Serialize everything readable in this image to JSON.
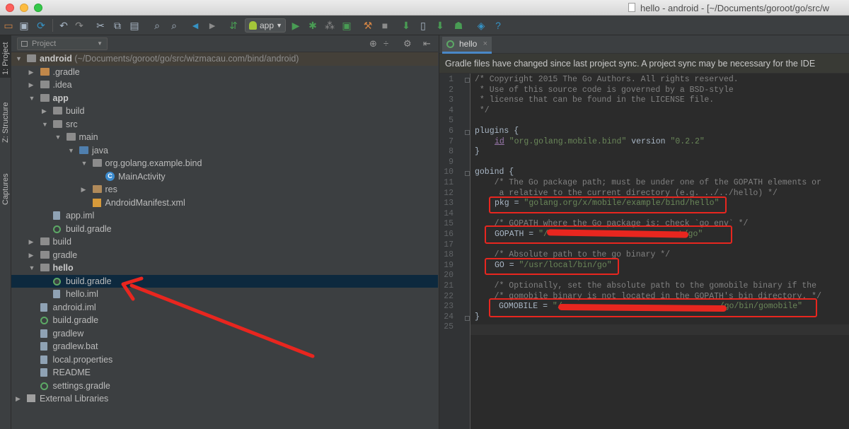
{
  "window": {
    "title": "hello - android - [~/Documents/goroot/go/src/w"
  },
  "toolbar": {
    "run_config": "app",
    "icons": [
      "open-folder-icon",
      "save-icon",
      "sync-icon",
      "undo-icon",
      "redo-icon",
      "cut-icon",
      "copy-icon",
      "paste-icon",
      "find-icon",
      "replace-icon",
      "back-icon",
      "forward-icon",
      "make-icon",
      "run-icon",
      "debug-icon",
      "attach-icon",
      "run-coverage-icon",
      "stop-icon",
      "project-structure-icon",
      "sdk-manager-icon",
      "avd-manager-icon",
      "android-device-monitor-icon",
      "sync-gradle-icon",
      "help-icon"
    ]
  },
  "stripe": {
    "tabs": [
      "1: Project",
      "Z: Structure",
      "Captures"
    ]
  },
  "project": {
    "view_label": "Project",
    "tree": [
      {
        "label": "android",
        "sub": "(~/Documents/goroot/go/src/wizmacau.com/bind/android)",
        "icon": "module-folder",
        "level": 0,
        "arrow": "down",
        "bold": true
      },
      {
        "label": ".gradle",
        "icon": "folder-orange",
        "level": 1,
        "arrow": "right"
      },
      {
        "label": ".idea",
        "icon": "folder",
        "level": 1,
        "arrow": "right"
      },
      {
        "label": "app",
        "icon": "module-folder",
        "level": 1,
        "arrow": "down",
        "bold": true
      },
      {
        "label": "build",
        "icon": "folder",
        "level": 2,
        "arrow": "right"
      },
      {
        "label": "src",
        "icon": "folder",
        "level": 2,
        "arrow": "down"
      },
      {
        "label": "main",
        "icon": "folder",
        "level": 3,
        "arrow": "down"
      },
      {
        "label": "java",
        "icon": "folder-blue",
        "level": 4,
        "arrow": "down"
      },
      {
        "label": "org.golang.example.bind",
        "icon": "package",
        "level": 5,
        "arrow": "down"
      },
      {
        "label": "MainActivity",
        "icon": "class",
        "level": 6,
        "arrow": ""
      },
      {
        "label": "res",
        "icon": "folder-tan",
        "level": 5,
        "arrow": "right"
      },
      {
        "label": "AndroidManifest.xml",
        "icon": "xml",
        "level": 5,
        "arrow": ""
      },
      {
        "label": "app.iml",
        "icon": "iml",
        "level": 2,
        "arrow": ""
      },
      {
        "label": "build.gradle",
        "icon": "gradle",
        "level": 2,
        "arrow": ""
      },
      {
        "label": "build",
        "icon": "folder",
        "level": 1,
        "arrow": "right"
      },
      {
        "label": "gradle",
        "icon": "folder",
        "level": 1,
        "arrow": "right"
      },
      {
        "label": "hello",
        "icon": "module-folder",
        "level": 1,
        "arrow": "down",
        "bold": true
      },
      {
        "label": "build.gradle",
        "icon": "gradle",
        "level": 2,
        "arrow": "",
        "selected": true
      },
      {
        "label": "hello.iml",
        "icon": "iml",
        "level": 2,
        "arrow": ""
      },
      {
        "label": "android.iml",
        "icon": "iml",
        "level": 1,
        "arrow": ""
      },
      {
        "label": "build.gradle",
        "icon": "gradle",
        "level": 1,
        "arrow": ""
      },
      {
        "label": "gradlew",
        "icon": "file",
        "level": 1,
        "arrow": ""
      },
      {
        "label": "gradlew.bat",
        "icon": "file",
        "level": 1,
        "arrow": ""
      },
      {
        "label": "local.properties",
        "icon": "file",
        "level": 1,
        "arrow": ""
      },
      {
        "label": "README",
        "icon": "file",
        "level": 1,
        "arrow": ""
      },
      {
        "label": "settings.gradle",
        "icon": "gradle",
        "level": 1,
        "arrow": ""
      },
      {
        "label": "External Libraries",
        "icon": "library",
        "level": 0,
        "arrow": "right"
      }
    ]
  },
  "editor": {
    "tab_label": "hello",
    "notice": "Gradle files have changed since last project sync. A project sync may be necessary for the IDE",
    "lines": [
      "/* Copyright 2015 The Go Authors. All rights reserved.",
      " * Use of this source code is governed by a BSD-style",
      " * license that can be found in the LICENSE file.",
      " */",
      "",
      "plugins {",
      "    id \"org.golang.mobile.bind\" version \"0.2.2\"",
      "}",
      "",
      "gobind {",
      "    /* The Go package path; must be under one of the GOPATH elements or",
      "     a relative to the current directory (e.g. ../../hello) */",
      "    pkg = \"golang.org/x/mobile/example/bind/hello\"",
      "",
      "    /* GOPATH where the Go package is; check `go env` */",
      "    GOPATH = \"/Users/...oot/go\"",
      "",
      "    /* Absolute path to the go binary */",
      "    GO = \"/usr/local/bin/go\"",
      "",
      "    /* Optionally, set the absolute path to the gomobile binary if the",
      "    /* gomobile binary is not located in the GOPATH's bin directory. */",
      "    GOMOBILE = \"/Users/.../go/bin/gomobile\"",
      "}",
      ""
    ],
    "display": {
      "l1": "/* Copyright 2015 The Go Authors. All rights reserved.",
      "l2": " * Use of this source code is governed by a BSD-style",
      "l3": " * license that can be found in the LICENSE file.",
      "l4": " */",
      "l6": "plugins {",
      "l7a": "id",
      "l7b": "\"org.golang.mobile.bind\"",
      "l7c": "version",
      "l7d": "\"0.2.2\"",
      "l8": "}",
      "l10": "gobind {",
      "l11": "    /* The Go package path; must be under one of the GOPATH elements or",
      "l12": "     a relative to the current directory (e.g. ../../hello) */",
      "l13a": "pkg = ",
      "l13b": "\"golang.org/x/mobile/example/bind/hello\"",
      "l15": "    /* GOPATH where the Go package is; check `go env` */",
      "l16a": "GOPATH = ",
      "l16b": "\"/",
      "l16c": "oot/go\"",
      "l18": "    /* Absolute path to the go binary */",
      "l19a": "GO = ",
      "l19b": "\"/usr/local/bin/go\"",
      "l21": "    /* Optionally, set the absolute path to the gomobile binary if the",
      "l22": "    /* gomobile binary is not located in the GOPATH's bin directory. */",
      "l23a": "GOMOBILE = ",
      "l23b": "\"/",
      "l23c": "/go/bin/gomobile\"",
      "l24": "}"
    },
    "line_numbers": [
      "1",
      "2",
      "3",
      "4",
      "5",
      "6",
      "7",
      "8",
      "9",
      "10",
      "11",
      "12",
      "13",
      "14",
      "15",
      "16",
      "17",
      "18",
      "19",
      "20",
      "21",
      "22",
      "23",
      "24",
      "25"
    ]
  },
  "colors": {
    "annotation_red": "#e8261f",
    "selection": "#0d293e",
    "string_green": "#6a8759",
    "comment_grey": "#808080"
  }
}
